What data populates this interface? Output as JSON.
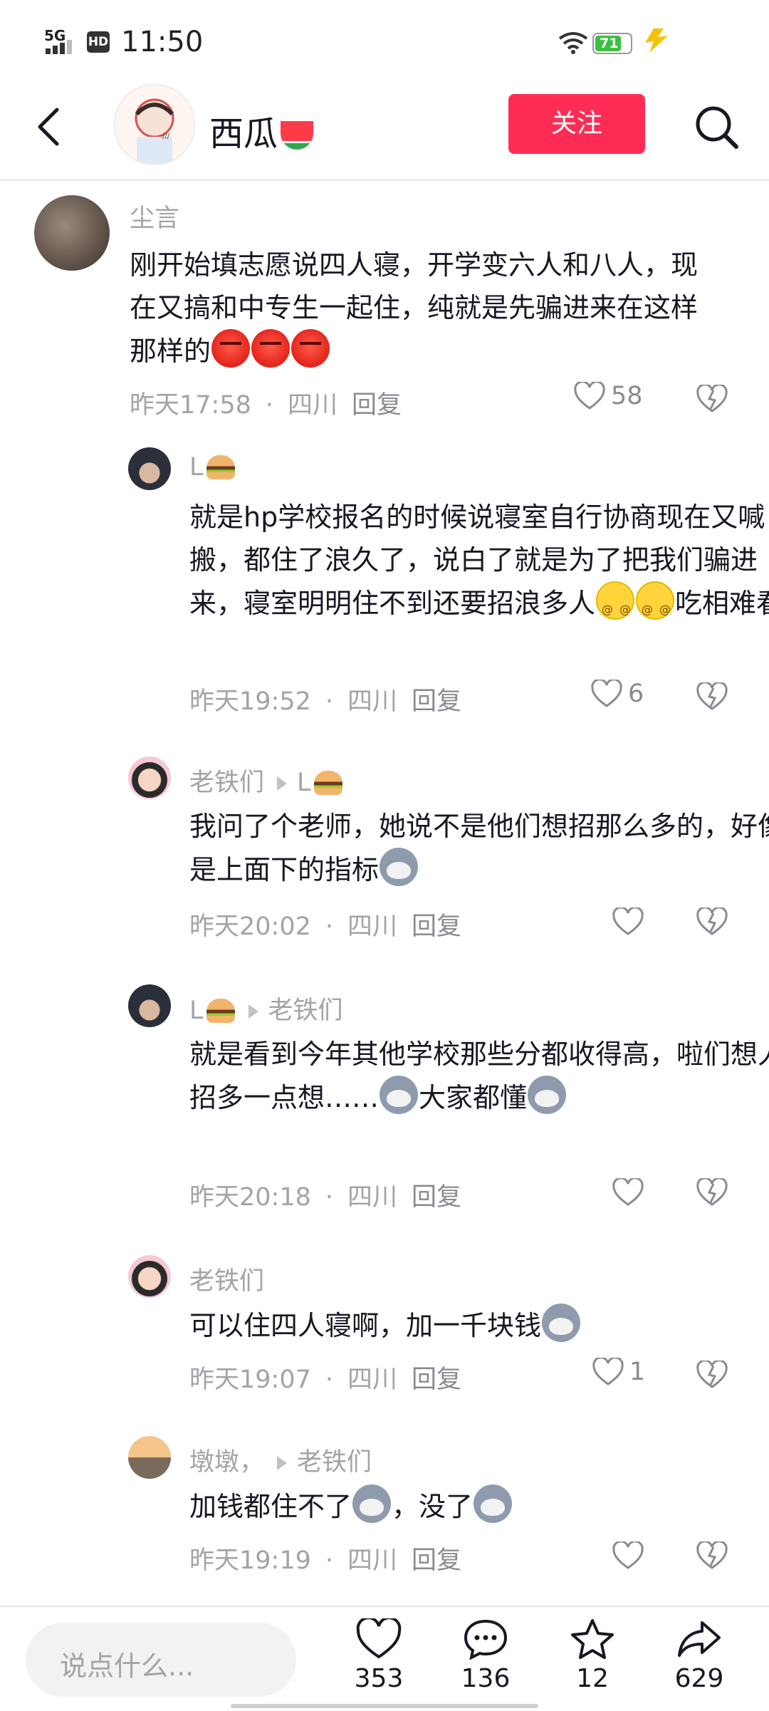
{
  "status_bar": {
    "network": "5G",
    "hd": "HD",
    "time": "11:50",
    "battery": "71"
  },
  "header": {
    "title": "西瓜",
    "follow_label": "关注"
  },
  "comments": [
    {
      "name": "尘言",
      "reply_to": "",
      "text": "刚开始填志愿说四人寝，开学变六人和八人，现在又搞和中专生一起住，纯就是先骗进来在这样那样的",
      "time": "昨天17:58",
      "location": "四川",
      "reply_label": "回复",
      "likes": "58"
    },
    {
      "name": "L",
      "reply_to": "",
      "text": "就是hp学校报名的时候说寝室自行协商现在又喊搬，都住了浪久了，说白了就是为了把我们骗进来，寝室明明住不到还要招浪多人",
      "text_suffix": "吃相难看",
      "time": "昨天19:52",
      "location": "四川",
      "reply_label": "回复",
      "likes": "6"
    },
    {
      "name": "老铁们",
      "reply_to": "L",
      "text": "我问了个老师，她说不是他们想招那么多的，好像是上面下的指标",
      "time": "昨天20:02",
      "location": "四川",
      "reply_label": "回复",
      "likes": ""
    },
    {
      "name": "L",
      "reply_to": "老铁们",
      "text": "就是看到今年其他学校那些分都收得高，啦们想人招多一点想……",
      "text_mid": "大家都懂",
      "time": "昨天20:18",
      "location": "四川",
      "reply_label": "回复",
      "likes": ""
    },
    {
      "name": "老铁们",
      "reply_to": "",
      "text": "可以住四人寝啊，加一千块钱",
      "time": "昨天19:07",
      "location": "四川",
      "reply_label": "回复",
      "likes": "1"
    },
    {
      "name": "墩墩，",
      "reply_to": "老铁们",
      "text": "加钱都住不了",
      "text_mid": "，没了",
      "time": "昨天19:19",
      "location": "四川",
      "reply_label": "回复",
      "likes": ""
    }
  ],
  "bottom_bar": {
    "input_placeholder": "说点什么...",
    "like_count": "353",
    "comment_count": "136",
    "favorite_count": "12",
    "share_count": "629"
  },
  "colors": {
    "accent": "#fe2c55",
    "secondary_text": "#a3a3a8"
  }
}
